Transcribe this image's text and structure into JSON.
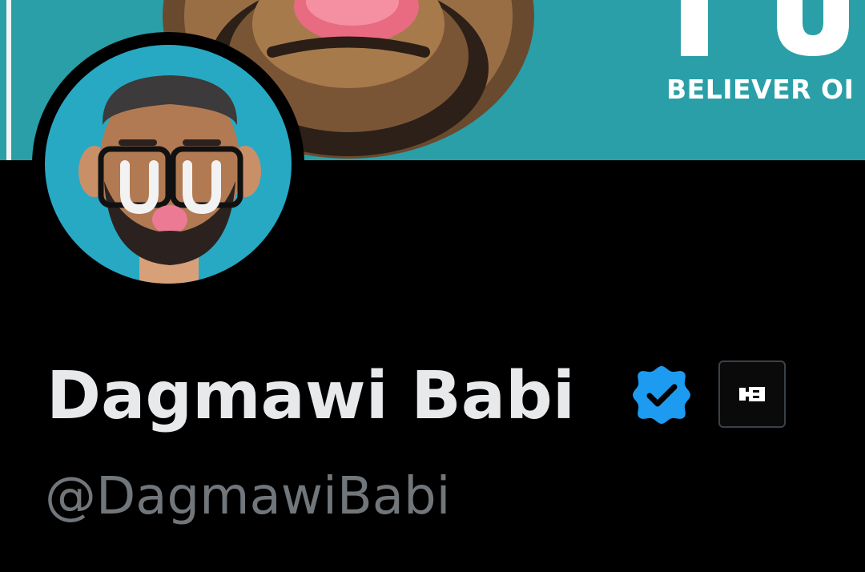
{
  "banner": {
    "tagline": "BELIEVER OI",
    "colors": {
      "background": "#2a9fa8"
    }
  },
  "profile": {
    "display_name": "Dagmawi Babi",
    "handle": "@DagmawiBabi",
    "verified": true,
    "avatar_icon": "avatar-icon",
    "affiliate_icon": "affiliate-logo-icon"
  },
  "colors": {
    "page_background": "#000000",
    "name_text": "#e7e9ea",
    "handle_text": "#71767b",
    "verified_blue": "#1d9bf0",
    "avatar_background": "#27a9c4"
  }
}
